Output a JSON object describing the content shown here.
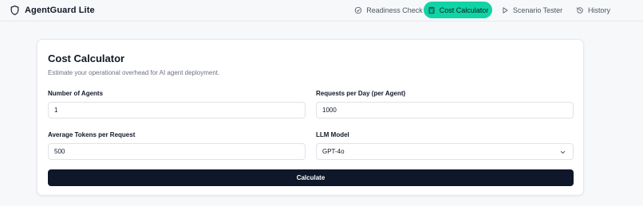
{
  "app": {
    "name": "AgentGuard Lite",
    "logo_icon": "shield-icon"
  },
  "nav": {
    "items": [
      {
        "label": "Readiness Check",
        "icon": "check-circle-icon",
        "active": false
      },
      {
        "label": "Cost Calculator",
        "icon": "calculator-icon",
        "active": true
      },
      {
        "label": "Scenario Tester",
        "icon": "play-icon",
        "active": false
      },
      {
        "label": "History",
        "icon": "history-icon",
        "active": false
      }
    ],
    "active_color": "#10d3a6"
  },
  "calculator": {
    "title": "Cost Calculator",
    "subtitle": "Estimate your operational overhead for AI agent deployment.",
    "fields": {
      "agents": {
        "label": "Number of Agents",
        "value": "1"
      },
      "requests": {
        "label": "Requests per Day (per Agent)",
        "value": "1000"
      },
      "tokens": {
        "label": "Average Tokens per Request",
        "value": "500"
      },
      "model": {
        "label": "LLM Model",
        "value": "GPT-4o"
      }
    },
    "calculate_label": "Calculate"
  }
}
